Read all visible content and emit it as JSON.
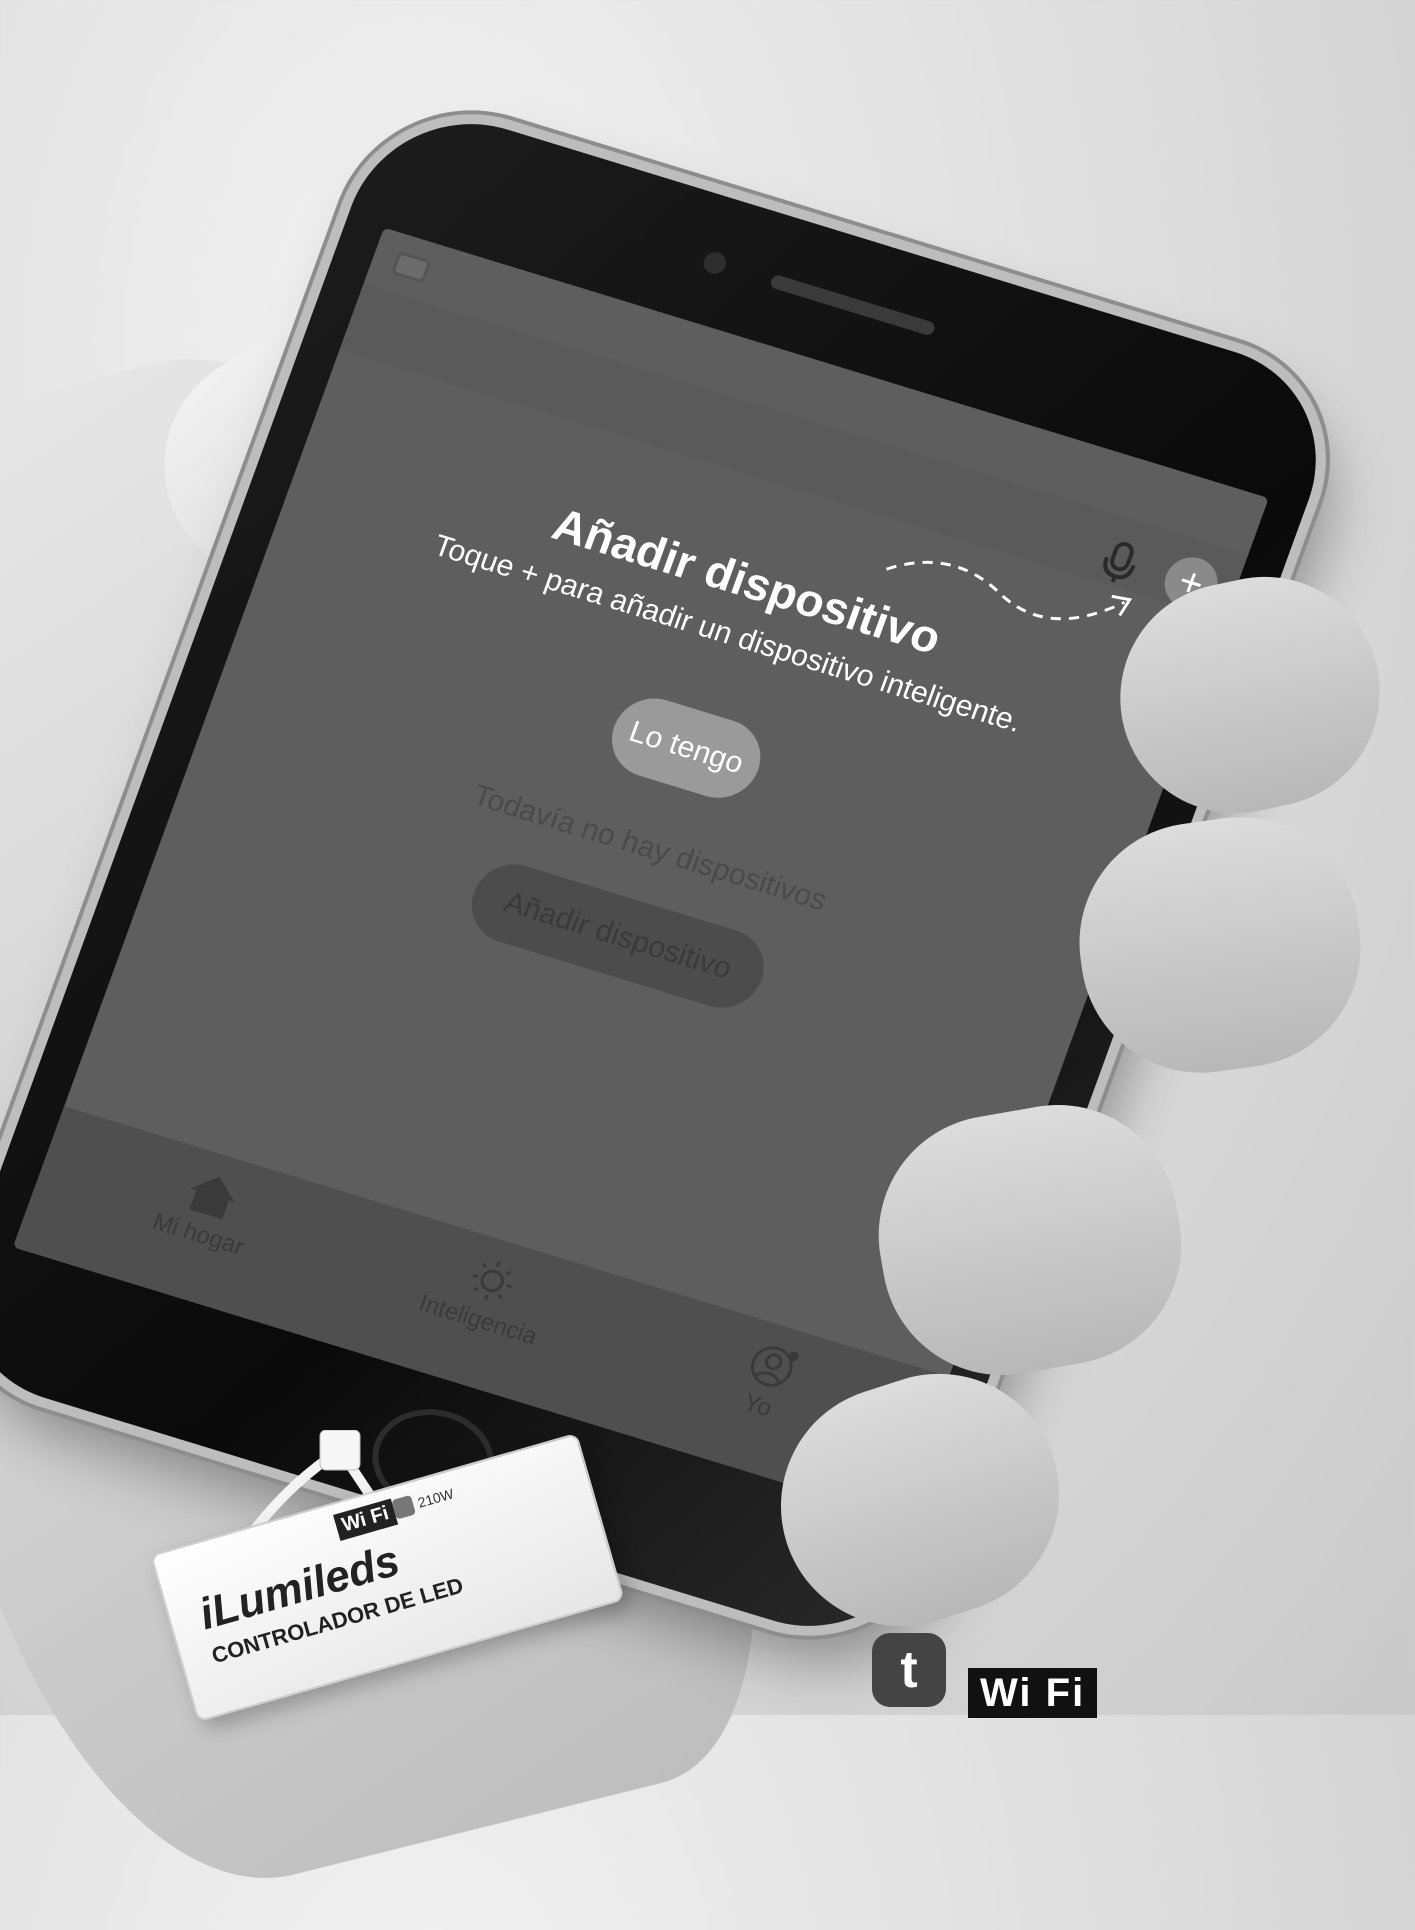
{
  "app": {
    "tip_title": "Añadir dispositivo",
    "tip_text": "Toque + para añadir un dispositivo inteligente.",
    "got_it_label": "Lo tengo",
    "empty_text": "Todavía no hay dispositivos",
    "add_device_label": "Añadir dispositivo",
    "add_button_glyph": "+",
    "tabs": [
      {
        "label": "Mi hogar",
        "icon": "home-icon"
      },
      {
        "label": "Inteligencia",
        "icon": "sun-icon"
      },
      {
        "label": "Yo",
        "icon": "user-icon"
      }
    ]
  },
  "product": {
    "brand": "iLumileds",
    "subtitle": "CONTROLADOR DE LED",
    "wifi_label": "Wi Fi",
    "power": "210W"
  },
  "badges": {
    "tuya_glyph": "t",
    "wifi_label": "Wi Fi"
  },
  "colors": {
    "screen_overlay": "#5e5e5e",
    "tuya_badge": "#444444"
  }
}
